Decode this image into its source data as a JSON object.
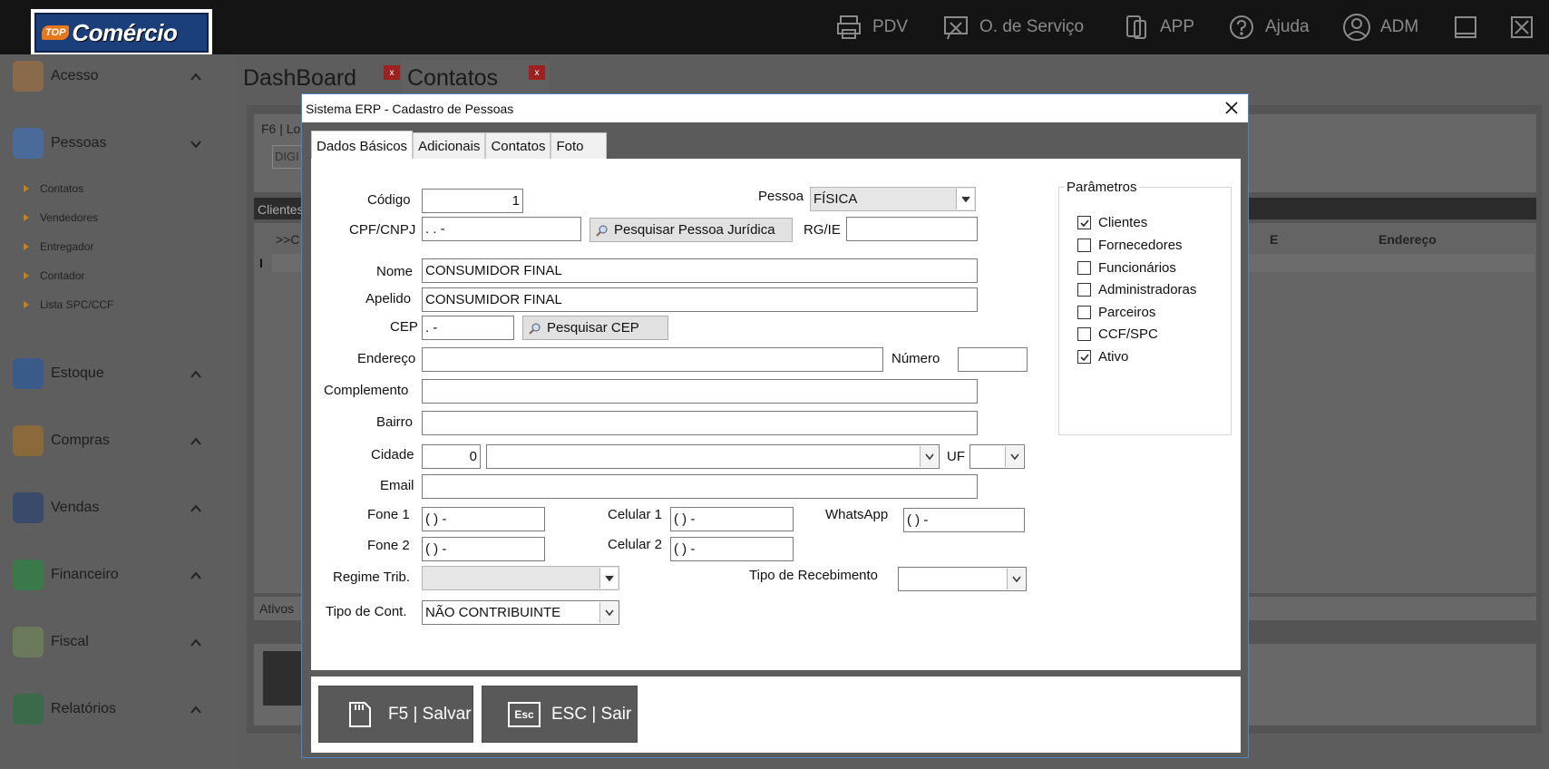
{
  "topbar": {
    "logo_top": "TOP",
    "logo_text": "Comércio",
    "nav": [
      {
        "label": "PDV",
        "icon": "printer-icon"
      },
      {
        "label": "O. de Serviço",
        "icon": "tools-icon"
      },
      {
        "label": "APP",
        "icon": "phone-icon"
      },
      {
        "label": "Ajuda",
        "icon": "help-icon"
      },
      {
        "label": "ADM",
        "icon": "user-icon"
      }
    ]
  },
  "sidebar": {
    "groups": [
      {
        "label": "Acesso"
      },
      {
        "label": "Pessoas"
      },
      {
        "label": "Estoque"
      },
      {
        "label": "Compras"
      },
      {
        "label": "Vendas"
      },
      {
        "label": "Financeiro"
      },
      {
        "label": "Fiscal"
      },
      {
        "label": "Relatórios"
      }
    ],
    "sub_items": [
      "Contatos",
      "Vendedores",
      "Entregador",
      "Contador",
      "Lista SPC/CCF"
    ]
  },
  "workspace": {
    "tabs": [
      "DashBoard",
      "Contatos"
    ],
    "tab_close": "x",
    "filter_label": "F6 | Lo",
    "filter_input": "DIGI",
    "grid_title": "Clientes",
    "grid_col_first": ">>C",
    "grid_col_e": "E",
    "grid_col_endereco": "Endereço",
    "row_marker": "I",
    "status": "Ativos"
  },
  "dialog": {
    "title": "Sistema ERP - Cadastro de Pessoas",
    "tabs": [
      "Dados Básicos",
      "Adicionais",
      "Contatos",
      "Foto"
    ],
    "labels": {
      "codigo": "Código",
      "pessoa": "Pessoa",
      "cpf": "CPF/CNPJ",
      "rg": "RG/IE",
      "nome": "Nome",
      "apelido": "Apelido",
      "cep": "CEP",
      "endereco": "Endereço",
      "numero": "Número",
      "complemento": "Complemento",
      "bairro": "Bairro",
      "cidade": "Cidade",
      "uf": "UF",
      "email": "Email",
      "fone1": "Fone 1",
      "celular1": "Celular 1",
      "whatsapp": "WhatsApp",
      "fone2": "Fone 2",
      "celular2": "Celular 2",
      "regime": "Regime Trib.",
      "tipo_receb": "Tipo de Recebimento",
      "tipo_cont": "Tipo de Cont."
    },
    "values": {
      "codigo": "1",
      "pessoa": "FÍSICA",
      "cpf": "  .   .   -",
      "rg": "",
      "nome": "CONSUMIDOR FINAL",
      "apelido": "CONSUMIDOR FINAL",
      "cep": "  .   -",
      "endereco": "",
      "numero": "",
      "complemento": "",
      "bairro": "",
      "cidade_codigo": "0",
      "cidade_nome": "",
      "uf": "",
      "email": "",
      "fone1": "( )     -",
      "celular1": "( )      -",
      "whatsapp": "( )      -",
      "fone2": "( )     -",
      "celular2": "( )      -",
      "regime": "",
      "tipo_receb": "",
      "tipo_cont": "NÃO CONTRIBUINTE"
    },
    "buttons": {
      "pesquisar_pj": "Pesquisar Pessoa Jurídica",
      "pesquisar_cep": "Pesquisar CEP"
    },
    "parametros": {
      "legend": "Parâmetros",
      "items": [
        {
          "label": "Clientes",
          "checked": true
        },
        {
          "label": "Fornecedores",
          "checked": false
        },
        {
          "label": "Funcionários",
          "checked": false
        },
        {
          "label": "Administradoras",
          "checked": false
        },
        {
          "label": "Parceiros",
          "checked": false
        },
        {
          "label": "CCF/SPC",
          "checked": false
        },
        {
          "label": "Ativo",
          "checked": true
        }
      ]
    },
    "footer": {
      "save": "F5 | Salvar",
      "exit": "ESC | Sair",
      "esc_key": "Esc"
    }
  }
}
